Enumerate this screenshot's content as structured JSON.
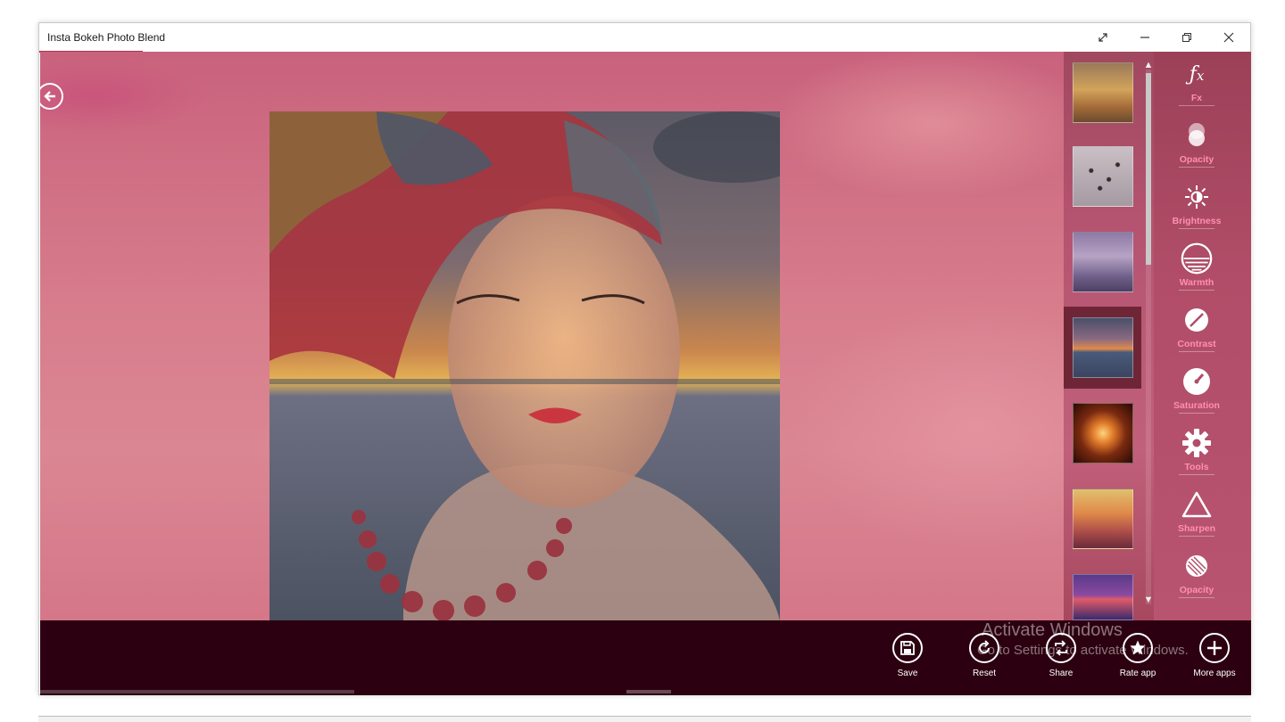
{
  "window": {
    "title": "Insta Bokeh Photo Blend",
    "controls": [
      "expand-icon",
      "minimize-icon",
      "restore-icon",
      "close-icon"
    ]
  },
  "thumbnails": {
    "items": [
      {
        "name": "golden clouds",
        "selected": false
      },
      {
        "name": "birds on sky",
        "selected": false
      },
      {
        "name": "purple clouds",
        "selected": false
      },
      {
        "name": "sunset sea",
        "selected": true
      },
      {
        "name": "bokeh burst",
        "selected": false
      },
      {
        "name": "orange sunset",
        "selected": false
      },
      {
        "name": "purple sunset",
        "selected": false
      }
    ],
    "scroll_up": "▲",
    "scroll_down": "▼"
  },
  "tools": [
    {
      "label": "Fx",
      "icon": "fx-icon"
    },
    {
      "label": "Opacity",
      "icon": "opacity-icon"
    },
    {
      "label": "Brightness",
      "icon": "brightness-icon"
    },
    {
      "label": "Warmth",
      "icon": "warmth-icon"
    },
    {
      "label": "Contrast",
      "icon": "contrast-icon"
    },
    {
      "label": "Saturation",
      "icon": "saturation-icon"
    },
    {
      "label": "Tools",
      "icon": "gear-icon"
    },
    {
      "label": "Sharpen",
      "icon": "triangle-icon"
    },
    {
      "label": "Opacity",
      "icon": "opacity-stripes-icon"
    }
  ],
  "bottom_bar": {
    "buttons": [
      {
        "label": "Save",
        "icon": "save-icon"
      },
      {
        "label": "Reset",
        "icon": "reset-icon"
      },
      {
        "label": "Share",
        "icon": "share-icon"
      },
      {
        "label": "Rate app",
        "icon": "star-icon"
      },
      {
        "label": "More apps",
        "icon": "plus-icon"
      }
    ]
  },
  "watermark": {
    "line1": "Activate Windows",
    "line2": "Go to Settings to activate Windows."
  },
  "colors": {
    "accent_pink": "#ff8fb0",
    "bottom_bar": "#2c0010",
    "panel": "#b14d68"
  }
}
